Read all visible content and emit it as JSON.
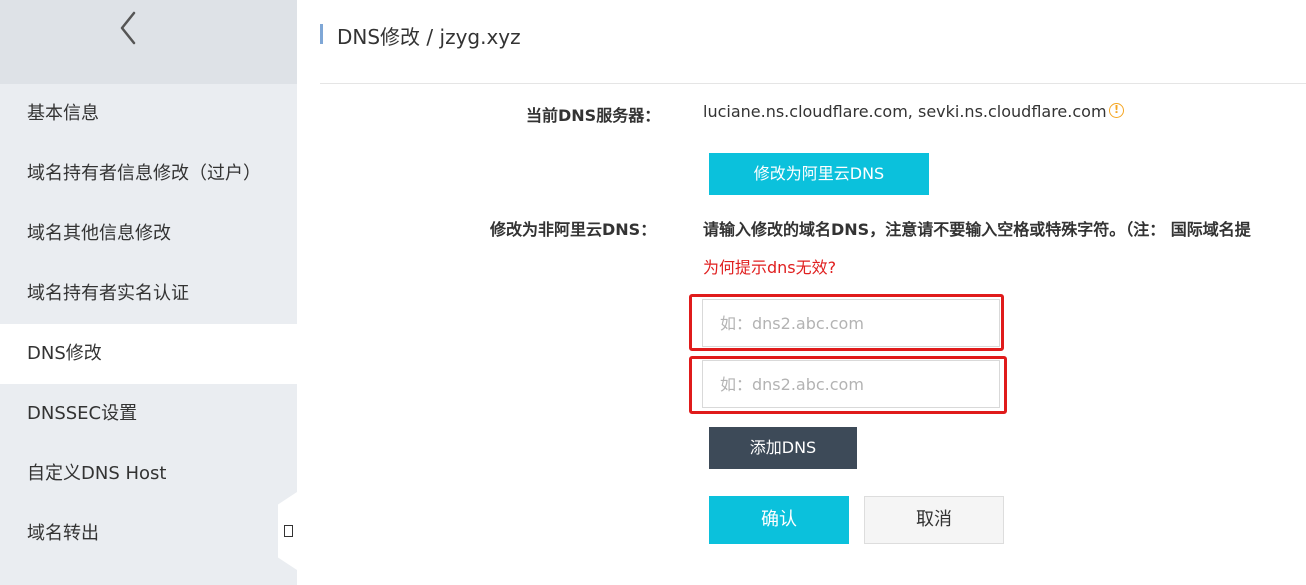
{
  "sidebar": {
    "back_icon": "chevron-left-icon",
    "items": [
      {
        "label": "基本信息"
      },
      {
        "label": "域名持有者信息修改（过户）"
      },
      {
        "label": "域名其他信息修改"
      },
      {
        "label": "域名持有者实名认证"
      },
      {
        "label": "DNS修改"
      },
      {
        "label": "DNSSEC设置"
      },
      {
        "label": "自定义DNS Host"
      },
      {
        "label": "域名转出"
      }
    ],
    "active_item": "DNS修改",
    "collapse_icon": "sidebar-collapse-icon"
  },
  "header": {
    "title": "DNS修改 / jzyg.xyz"
  },
  "form": {
    "current_dns_label": "当前DNS服务器：",
    "current_dns_value": "luciane.ns.cloudflare.com, sevki.ns.cloudflare.com",
    "warning_icon": "warning-circle-icon",
    "aliyun_button": "修改为阿里云DNS",
    "non_aliyun_label": "修改为非阿里云DNS：",
    "instruction": "请输入修改的域名DNS，注意请不要输入空格或特殊字符。（注： 国际域名提",
    "help_link": "为何提示dns无效?",
    "dns_input_1": {
      "placeholder": "如：dns2.abc.com",
      "value": ""
    },
    "dns_input_2": {
      "placeholder": "如：dns2.abc.com",
      "value": ""
    },
    "add_dns_button": "添加DNS",
    "confirm_button": "确认",
    "cancel_button": "取消"
  },
  "colors": {
    "accent": "#0bc1dc",
    "dark_button": "#3d4a58",
    "link_red": "#e02020",
    "highlight_frame": "#e01b1b",
    "warning": "#f5a623"
  }
}
